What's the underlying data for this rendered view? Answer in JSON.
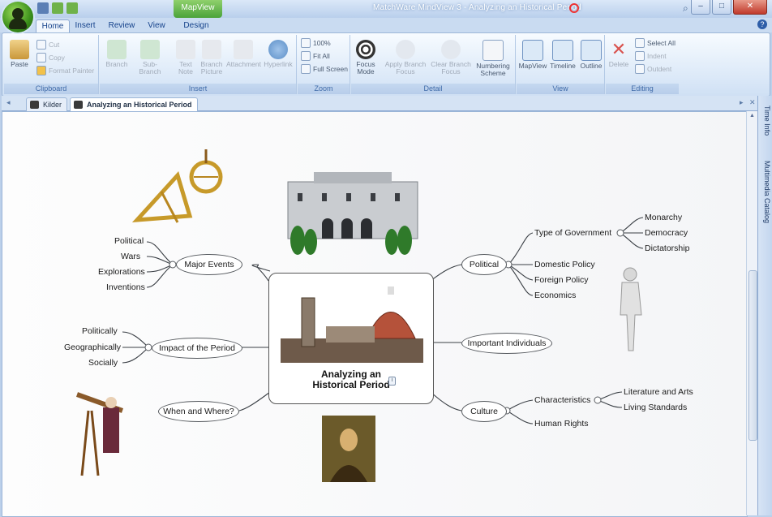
{
  "window": {
    "title": "MatchWare MindView 3 - Analyzing an Historical Period",
    "context_tab": "MapView"
  },
  "ribbon_tabs": [
    "Home",
    "Insert",
    "Review",
    "View",
    "Design"
  ],
  "ribbon": {
    "clipboard": {
      "name": "Clipboard",
      "paste": "Paste",
      "cut": "Cut",
      "copy": "Copy",
      "format_painter": "Format Painter"
    },
    "insert": {
      "name": "Insert",
      "branch": "Branch",
      "sub_branch": "Sub-Branch",
      "text_note": "Text Note",
      "branch_picture": "Branch Picture",
      "attachment": "Attachment",
      "hyperlink": "Hyperlink"
    },
    "zoom": {
      "name": "Zoom",
      "percent": "100%",
      "fit_all": "Fit All",
      "full_screen": "Full Screen"
    },
    "detail": {
      "name": "Detail",
      "focus_mode": "Focus Mode",
      "apply_branch_focus": "Apply Branch Focus",
      "clear_branch_focus": "Clear Branch Focus",
      "numbering_scheme": "Numbering Scheme"
    },
    "view": {
      "name": "View",
      "mapview": "MapView",
      "timeline": "Timeline",
      "outline": "Outline"
    },
    "editing": {
      "name": "Editing",
      "delete": "Delete",
      "select_all": "Select All",
      "indent": "Indent",
      "outdent": "Outdent"
    }
  },
  "doc_tabs": [
    "Kilder",
    "Analyzing an Historical Period"
  ],
  "side_tabs": [
    "Time Info",
    "Multimedia Catalog"
  ],
  "mindmap": {
    "center": {
      "line1": "Analyzing an",
      "line2": "Historical Period"
    },
    "branches": {
      "major_events": "Major Events",
      "political": "Political",
      "important_individuals": "Important Individuals",
      "impact": "Impact of the Period",
      "when_where": "When and Where?",
      "culture": "Culture"
    },
    "major_events_children": [
      "Political",
      "Wars",
      "Explorations",
      "Inventions"
    ],
    "impact_children": [
      "Politically",
      "Geographically",
      "Socially"
    ],
    "political_children": {
      "type_of_government": "Type of Government",
      "domestic_policy": "Domestic Policy",
      "foreign_policy": "Foreign Policy",
      "economics": "Economics"
    },
    "government_children": [
      "Monarchy",
      "Democracy",
      "Dictatorship"
    ],
    "culture_children": {
      "characteristics": "Characteristics",
      "human_rights": "Human Rights"
    },
    "characteristics_children": [
      "Literature and Arts",
      "Living Standards"
    ]
  },
  "colors": {
    "ribbon_blue": "#15428b",
    "context_green": "#4aa33a",
    "title_text": "#ffffff"
  }
}
